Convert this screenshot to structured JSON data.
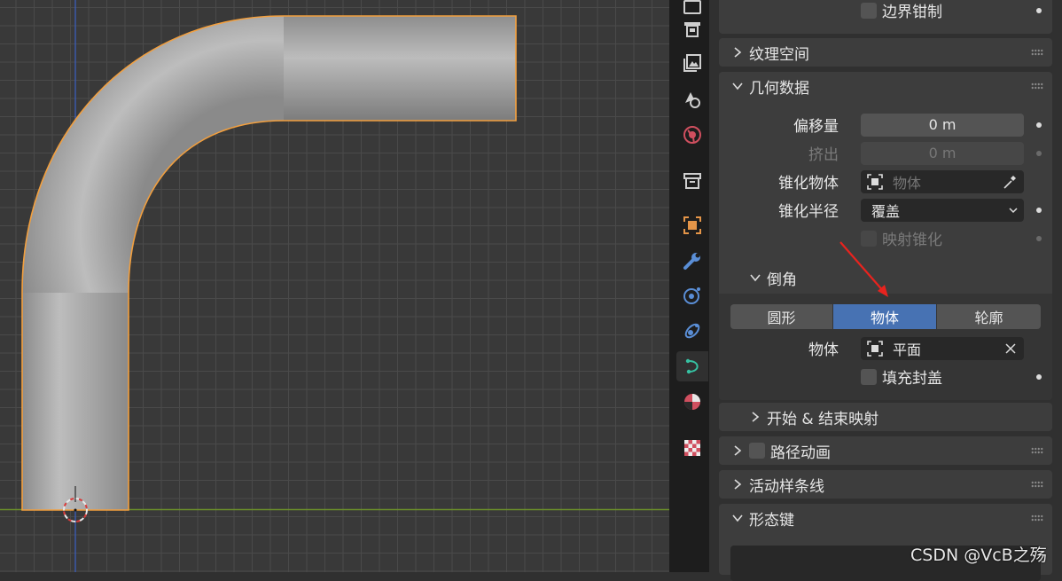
{
  "viewport": {
    "object_color": "#a6a6a6",
    "outline_color": "#f29f3e",
    "x_axis_color": "#6b8f2a",
    "y_axis_color": "#3a5fc4"
  },
  "tabs": [
    {
      "icon": "render-output-icon"
    },
    {
      "icon": "output-printer-icon"
    },
    {
      "icon": "view-layer-icon"
    },
    {
      "icon": "scene-icon"
    },
    {
      "icon": "world-icon"
    },
    {
      "icon": "collection-icon"
    },
    {
      "icon": "object-icon"
    },
    {
      "icon": "modifier-wrench-icon"
    },
    {
      "icon": "particles-icon"
    },
    {
      "icon": "physics-icon"
    },
    {
      "icon": "curve-data-icon",
      "active": true
    },
    {
      "icon": "material-icon"
    },
    {
      "icon": "texture-icon"
    }
  ],
  "panel": {
    "clamp_label": "边界钳制",
    "texture_space": "纹理空间",
    "geometry": {
      "title": "几何数据",
      "offset_label": "偏移量",
      "offset_value": "0 m",
      "extrude_label": "挤出",
      "extrude_value": "0 m",
      "taper_object_label": "锥化物体",
      "taper_object_placeholder": "物体",
      "taper_radius_label": "锥化半径",
      "taper_radius_value": "覆盖",
      "map_taper_label": "映射锥化"
    },
    "bevel": {
      "title": "倒角",
      "modes": [
        "圆形",
        "物体",
        "轮廓"
      ],
      "selected_mode": "物体",
      "object_label": "物体",
      "object_value": "平面",
      "fill_caps_label": "填充封盖"
    },
    "start_end_mapping": "开始 & 结束映射",
    "path_animation": "路径动画",
    "active_spline": "活动样条线",
    "shape_keys": "形态键"
  },
  "watermark": "CSDN @VcB之殇"
}
